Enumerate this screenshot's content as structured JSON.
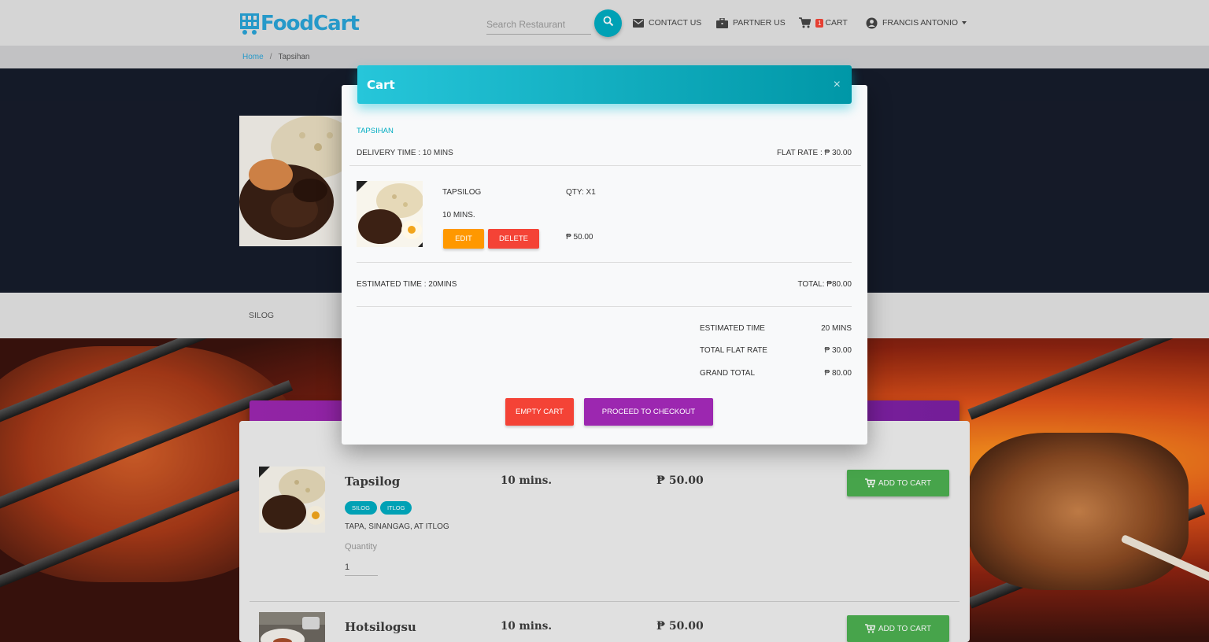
{
  "nav": {
    "logo": "FoodCart",
    "search_placeholder": "Search Restaurant",
    "contact": "CONTACT US",
    "partner": "PARTNER US",
    "cart_label": "CART",
    "cart_count": "1",
    "user": "FRANCIS ANTONIO"
  },
  "breadcrumb": {
    "home": "Home",
    "sep": "/",
    "current": "Tapsihan"
  },
  "category": {
    "label": "SILOG"
  },
  "menu": {
    "items": [
      {
        "name": "Tapsilog",
        "time": "10 mins.",
        "price": "₱ 50.00",
        "add_label": "ADD TO CART",
        "tags": [
          "SILOG",
          "ITLOG"
        ],
        "description": "TAPA, SINANGAG, AT ITLOG",
        "quantity_label": "Quantity",
        "quantity": "1"
      },
      {
        "name": "Hotsilogsu",
        "time": "10 mins.",
        "price": "₱ 50.00",
        "add_label": "ADD TO CART"
      }
    ]
  },
  "modal": {
    "title": "Cart",
    "close": "×",
    "restaurant": "TAPSIHAN",
    "delivery_time": "DELIVERY TIME : 10 MINS",
    "flat_rate": "FLAT RATE : ₱ 30.00",
    "item": {
      "name": "TAPSILOG",
      "qty": "QTY: X1",
      "time": "10 MINS.",
      "price": "₱ 50.00",
      "edit": "EDIT",
      "delete": "DELETE"
    },
    "estimated_time": "ESTIMATED TIME : 20MINS",
    "total": "TOTAL: ₱80.00",
    "summary": {
      "est_label": "ESTIMATED TIME",
      "est_value": "20 MINS",
      "flat_label": "TOTAL FLAT RATE",
      "flat_value": "₱ 30.00",
      "grand_label": "GRAND TOTAL",
      "grand_value": "₱ 80.00"
    },
    "empty_cart": "EMPTY CART",
    "checkout": "PROCEED TO CHECKOUT"
  },
  "colors": {
    "accent": "#00acc1",
    "purple": "#9c27b0",
    "green": "#4caf50",
    "red": "#f44336",
    "orange": "#ff9800",
    "hero_dark": "#161c2b"
  }
}
